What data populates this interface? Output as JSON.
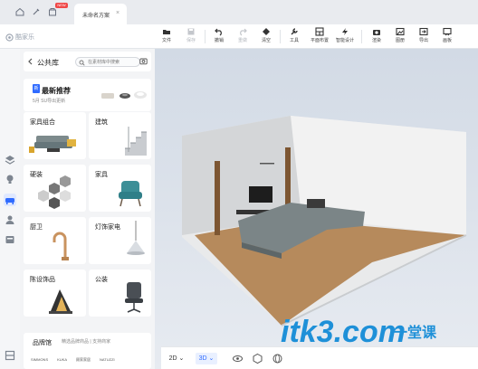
{
  "tabs": {
    "new_badge": "NEW",
    "doc_title": "未命名方案",
    "close": "×"
  },
  "app": {
    "brand": "酷家乐"
  },
  "toolbar": {
    "file": "文件",
    "save": "保存",
    "undo": "撤销",
    "redo": "重做",
    "clear": "清空",
    "tools": "工具",
    "floorplan": "平面布置",
    "smart": "智能设计",
    "render": "渲染",
    "drawing": "图册",
    "export": "导出",
    "draw": "画板"
  },
  "panel": {
    "title": "公共库",
    "search_placeholder": "在素材库中搜索",
    "rec_badge": "新",
    "rec_title": "最新推荐",
    "rec_sub": "5月 SU导出更新",
    "categories": [
      "家具组合",
      "建筑",
      "硬装",
      "家具",
      "厨卫",
      "灯饰家电",
      "陈设饰品",
      "公装"
    ],
    "brand_title": "品牌馆",
    "brand_sub": "精选品牌商品 | 支持商家",
    "brand_logos": [
      "SIMMONS",
      "KUKA",
      "顾家家居",
      "NATUZZI"
    ]
  },
  "viewbar": {
    "mode_2d": "2D",
    "mode_3d": "3D",
    "dropdown": "⌄"
  },
  "watermark": {
    "main": "itk3.com",
    "sub": "一堂课"
  },
  "colors": {
    "accent": "#2f6bff",
    "watermark": "#1e90d8",
    "badge": "#f04848"
  }
}
